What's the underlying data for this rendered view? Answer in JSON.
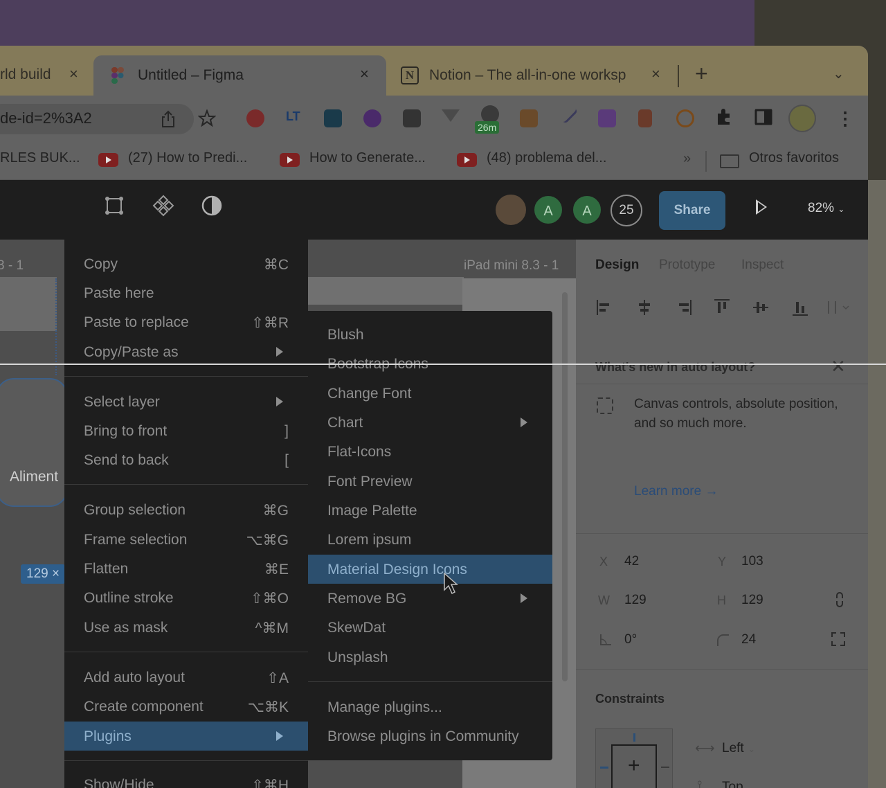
{
  "tabs": [
    {
      "label": "rld build",
      "close": "×"
    },
    {
      "label": "Untitled – Figma",
      "close": "×"
    },
    {
      "label": "Notion – The all-in-one worksp",
      "close": "×"
    }
  ],
  "new_tab": "+",
  "tab_menu": "⌄",
  "address": {
    "url": "de-id=2%3A2"
  },
  "extensions": {
    "timer_badge": "26m"
  },
  "bookmarks": {
    "items": [
      "RLES BUK...",
      "(27) How to Predi...",
      "How to Generate...",
      "(48) problema del..."
    ],
    "more": "»",
    "other_folder": "Otros favoritos"
  },
  "figma": {
    "avatars": [
      "A",
      "A"
    ],
    "avatar_count": "25",
    "share_label": "Share",
    "zoom": "82%"
  },
  "canvas": {
    "frame_label_left": "3 - 1",
    "frame_label_right": "iPad mini 8.3 - 1",
    "card_text": "Aliment",
    "size_badge": "129 ×"
  },
  "context_menu": {
    "items": [
      {
        "label": "Copy",
        "shortcut": "⌘C"
      },
      {
        "label": "Paste here",
        "shortcut": ""
      },
      {
        "label": "Paste to replace",
        "shortcut": "⇧⌘R"
      },
      {
        "label": "Copy/Paste as",
        "shortcut": "",
        "submenu": true
      },
      {
        "label": "Select layer",
        "shortcut": "",
        "submenu": true
      },
      {
        "label": "Bring to front",
        "shortcut": "]"
      },
      {
        "label": "Send to back",
        "shortcut": "["
      },
      {
        "label": "Group selection",
        "shortcut": "⌘G"
      },
      {
        "label": "Frame selection",
        "shortcut": "⌥⌘G"
      },
      {
        "label": "Flatten",
        "shortcut": "⌘E"
      },
      {
        "label": "Outline stroke",
        "shortcut": "⇧⌘O"
      },
      {
        "label": "Use as mask",
        "shortcut": "^⌘M"
      },
      {
        "label": "Add auto layout",
        "shortcut": "⇧A"
      },
      {
        "label": "Create component",
        "shortcut": "⌥⌘K"
      },
      {
        "label": "Plugins",
        "shortcut": "",
        "submenu": true,
        "active": true
      },
      {
        "label": "Show/Hide",
        "shortcut": "⇧⌘H"
      }
    ]
  },
  "plugins_menu": {
    "items": [
      {
        "label": "Blush"
      },
      {
        "label": "Bootstrap Icons"
      },
      {
        "label": "Change Font"
      },
      {
        "label": "Chart",
        "submenu": true
      },
      {
        "label": "Flat-Icons"
      },
      {
        "label": "Font Preview"
      },
      {
        "label": "Image Palette"
      },
      {
        "label": "Lorem ipsum"
      },
      {
        "label": "Material Design Icons",
        "hover": true
      },
      {
        "label": "Remove BG",
        "submenu": true
      },
      {
        "label": "SkewDat"
      },
      {
        "label": "Unsplash"
      }
    ],
    "manage": "Manage plugins...",
    "browse": "Browse plugins in Community"
  },
  "design_panel": {
    "tabs": [
      "Design",
      "Prototype",
      "Inspect"
    ],
    "news": {
      "title": "What's new in auto layout?",
      "close": "✕",
      "body": "Canvas controls, absolute position, and so much more.",
      "link": "Learn more →"
    },
    "props": {
      "x_label": "X",
      "x": "42",
      "y_label": "Y",
      "y": "103",
      "w_label": "W",
      "w": "129",
      "h_label": "H",
      "h": "129",
      "rotation": "0°",
      "radius": "24"
    },
    "constraints": {
      "title": "Constraints",
      "horizontal": "Left",
      "vertical": "Top"
    }
  },
  "colors": {
    "accent": "#2c4f6e",
    "share": "#2d5777",
    "avatar_green": "#2f6b3f"
  }
}
